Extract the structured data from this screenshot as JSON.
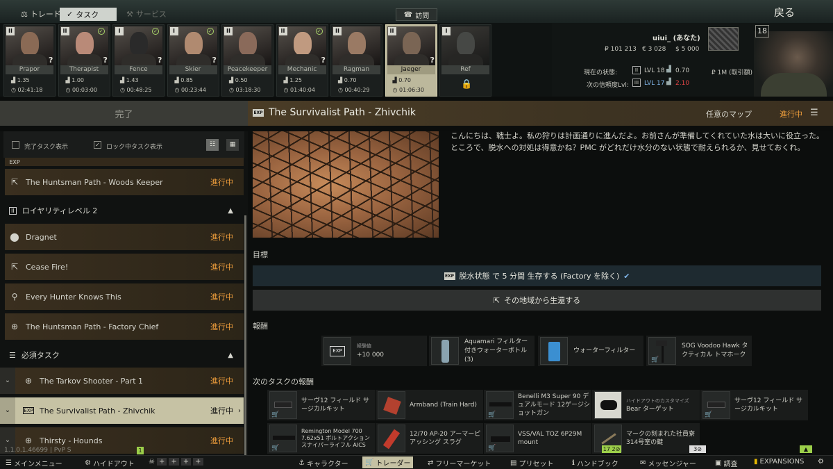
{
  "topbar": {
    "tab_trade": "トレード",
    "tab_tasks": "タスク",
    "tab_services": "サービス",
    "visit": "訪問",
    "back": "戻る"
  },
  "traders": [
    {
      "name": "Prapor",
      "level": "II",
      "rep": "1.35",
      "money": "02:41:18",
      "done": false,
      "q": true
    },
    {
      "name": "Therapist",
      "level": "II",
      "rep": "1.00",
      "money": "00:03:00",
      "done": true,
      "q": true
    },
    {
      "name": "Fence",
      "level": "I",
      "rep": "1.43",
      "money": "00:48:25",
      "done": true,
      "q": true
    },
    {
      "name": "Skier",
      "level": "I",
      "rep": "0.85",
      "money": "00:23:44",
      "done": true,
      "q": true
    },
    {
      "name": "Peacekeeper",
      "level": "II",
      "rep": "0.50",
      "money": "03:18:30",
      "done": false,
      "q": false
    },
    {
      "name": "Mechanic",
      "level": "II",
      "rep": "1.25",
      "money": "01:40:04",
      "done": true,
      "q": true
    },
    {
      "name": "Ragman",
      "level": "II",
      "rep": "0.70",
      "money": "00:40:29",
      "done": false,
      "q": false
    },
    {
      "name": "Jaeger",
      "level": "II",
      "rep": "0.70",
      "money": "01:06:30",
      "done": false,
      "q": true
    },
    {
      "name": "Ref",
      "level": "I",
      "rep": "",
      "money": "",
      "done": false,
      "q": false,
      "locked": true
    }
  ],
  "player": {
    "name": "uiui_ (あなた)",
    "roubles": "₽ 101 213",
    "euros": "€ 3 028",
    "dollars": "$ 5 000",
    "status_label": "現在の状態:",
    "status_lvl": "LVL 18",
    "status_rep": "0.70",
    "status_money": "₽ 1M (取引額)",
    "next_label": "次の信頼度Lvl:",
    "next_lvl": "LVL 17",
    "next_rep": "2.10",
    "level_badge": "18"
  },
  "header": {
    "left": "完了",
    "quest_title": "The Survivalist Path - Zhivchik",
    "map": "任意のマップ",
    "status": "進行中"
  },
  "filters": {
    "show_completed": "完了タスク表示",
    "show_locked": "ロック中タスク表示"
  },
  "quests": {
    "huntsman_woods": {
      "title": "The Huntsman Path - Woods Keeper",
      "status": "進行中"
    },
    "loyalty_group": "ロイヤリティレベル 2",
    "dragnet": {
      "title": "Dragnet",
      "status": "進行中"
    },
    "ceasefire": {
      "title": "Cease Fire!",
      "status": "進行中"
    },
    "every_hunter": {
      "title": "Every Hunter Knows This",
      "status": "進行中"
    },
    "huntsman_factory": {
      "title": "The Huntsman Path - Factory Chief",
      "status": "進行中"
    },
    "required_group": "必須タスク",
    "tarkov_shooter": {
      "title": "The Tarkov Shooter - Part 1",
      "status": "進行中"
    },
    "survivalist": {
      "title": "The Survivalist Path - Zhivchik",
      "status": "進行中"
    },
    "thirsty": {
      "title": "Thirsty - Hounds",
      "status": "進行中"
    }
  },
  "content": {
    "description": "こんにちは、戦士よ。私の狩りは計画通りに進んだよ。お前さんが準備してくれていた水は大いに役立った。ところで、脱水への対処は得意かね？PMC がどれだけ水分のない状態で耐えられるか、見せておくれ。",
    "objectives_label": "目標",
    "objective1": "脱水状態 で 5 分間 生存する (Factory を除く)",
    "objective2": "その地域から生還する",
    "rewards_label": "報酬",
    "rewards": [
      {
        "title": "経験値",
        "value": "+10 000"
      },
      {
        "title": "Aquamari フィルター付きウォーターボトル (3)"
      },
      {
        "title": "ウォーターフィルター"
      },
      {
        "title": "SOG Voodoo Hawk タクティカル トマホーク"
      }
    ],
    "next_label": "次のタスクの報酬",
    "next_rewards": [
      "サーヴ12 フィールド サージカルキット",
      "Armband (Train Hard)",
      "Benelli M3 Super 90 デュアルモード 12ゲージショットガン",
      "Bear ターゲット",
      "サーヴ12 フィールド サージカルキット",
      "Remington Model 700 7.62x51 ボルトアクションスナイパーライフル AICS",
      "12/70 AP-20 アーマーピアッシング スラグ",
      "VSS/VAL TOZ 6P29M mount",
      "マークの刻まれた社員寮 314号室の鍵"
    ],
    "hideout_caption": "ハイドアウトのカスタマイズ",
    "badge_17": "17",
    "badge_2": "2",
    "badge_3": "3"
  },
  "bottom": {
    "main": "メインメニュー",
    "hideout": "ハイドアウト",
    "character": "キャラクター",
    "traders": "トレーダー",
    "flea": "フリーマーケット",
    "presets": "プリセット",
    "handbook": "ハンドブック",
    "messenger": "メッセンジャー",
    "survey": "調査",
    "expansions": "EXPANSIONS",
    "version": "1.1.0.1.46699 | PvP S",
    "badge_1": "1"
  }
}
